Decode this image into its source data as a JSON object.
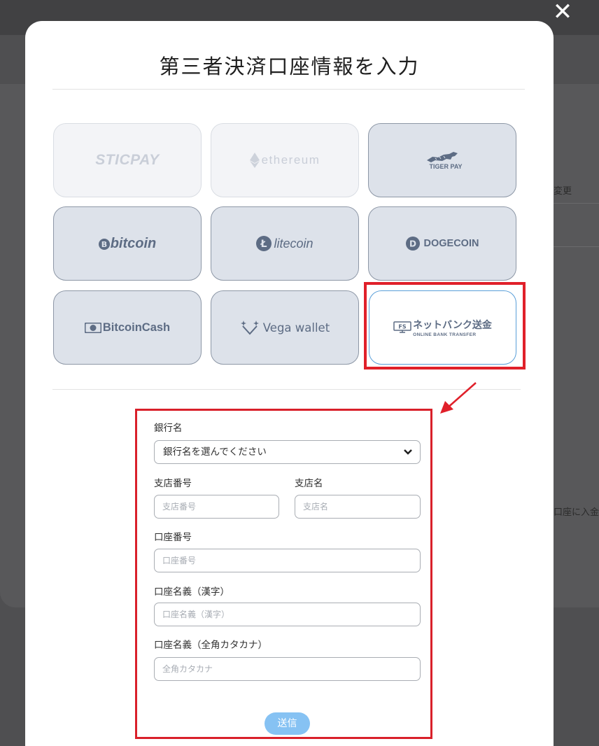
{
  "modal": {
    "title": "第三者決済口座情報を入力",
    "close_icon": "close-icon"
  },
  "background": {
    "text_change": "変更",
    "text_deposit": "口座に入金さ"
  },
  "payment_methods": [
    {
      "name": "STICPAY",
      "state": "disabled"
    },
    {
      "name": "ethereum",
      "state": "disabled"
    },
    {
      "name": "TIGER PAY",
      "state": "enabled"
    },
    {
      "name": "bitcoin",
      "state": "enabled"
    },
    {
      "name": "litecoin",
      "state": "enabled"
    },
    {
      "name": "DOGECOIN",
      "state": "enabled"
    },
    {
      "name": "BitcoinCash",
      "state": "enabled"
    },
    {
      "name": "Vega wallet",
      "state": "enabled"
    },
    {
      "name": "ネットバンク送金",
      "subtitle": "ONLINE BANK TRANSFER",
      "state": "selected"
    }
  ],
  "form": {
    "bank_label": "銀行名",
    "bank_select_value": "銀行名を選んでください",
    "branch_number_label": "支店番号",
    "branch_number_placeholder": "支店番号",
    "branch_name_label": "支店名",
    "branch_name_placeholder": "支店名",
    "account_number_label": "口座番号",
    "account_number_placeholder": "口座番号",
    "account_name_kanji_label": "口座名義（漢字）",
    "account_name_kanji_placeholder": "口座名義（漢字）",
    "account_name_kana_label": "口座名義（全角カタカナ）",
    "account_name_kana_placeholder": "全角カタカナ",
    "submit_label": "送信"
  },
  "colors": {
    "highlight": "#e0202a",
    "tile_bg": "#dde2ea",
    "tile_border": "#8d97a6",
    "submit": "#86c2f3",
    "selected_border": "#5a9fd9"
  }
}
